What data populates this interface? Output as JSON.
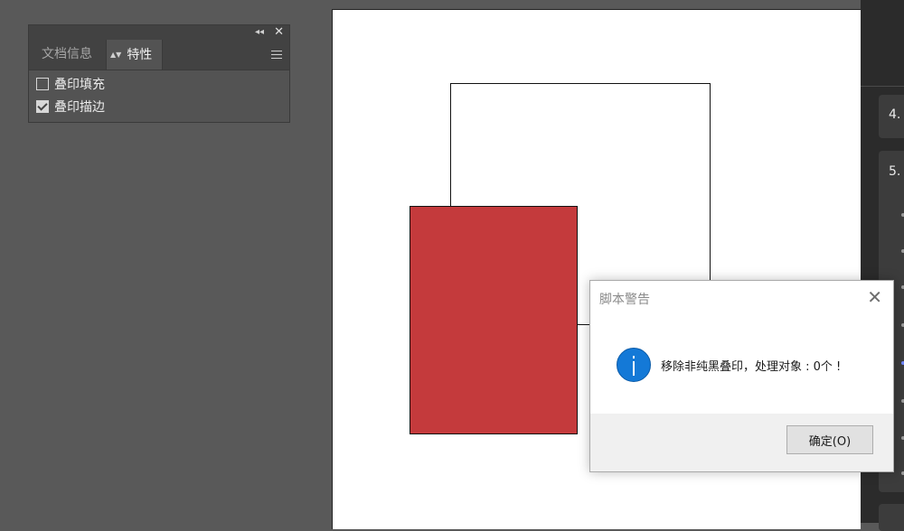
{
  "attributes_panel": {
    "tabs": [
      {
        "label": "文档信息"
      },
      {
        "label": "特性"
      }
    ],
    "options": [
      {
        "label": "叠印填充",
        "checked": false
      },
      {
        "label": "叠印描边",
        "checked": true
      }
    ]
  },
  "canvas": {
    "red_fill": "#c43a3c"
  },
  "right_panel": {
    "items": [
      {
        "label": "4."
      },
      {
        "label": "5."
      }
    ]
  },
  "alert_dialog": {
    "title": "脚本警告",
    "message": "移除非纯黑叠印，处理对象 : 0个 !",
    "ok_label": "确定(O)",
    "icon": "info-icon"
  }
}
